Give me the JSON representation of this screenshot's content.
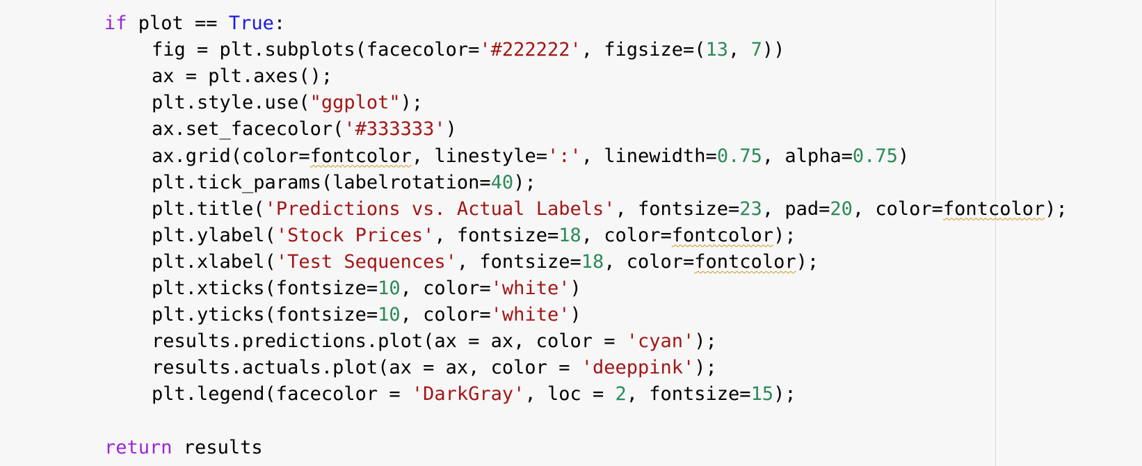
{
  "colors": {
    "background": "#f7f7f7",
    "keyword": "#9a26d6",
    "constant": "#1a1ae0",
    "string": "#a31515",
    "number": "#2b8a57",
    "default": "#000000",
    "squiggle": "#c89b1a",
    "ruler": "#dadada"
  },
  "code": {
    "lines": [
      {
        "indent": 1,
        "tokens": [
          {
            "t": "if",
            "k": "kw"
          },
          {
            "t": " plot == ",
            "k": "op"
          },
          {
            "t": "True",
            "k": "cn"
          },
          {
            "t": ":",
            "k": "op"
          }
        ]
      },
      {
        "indent": 2,
        "tokens": [
          {
            "t": "fig = plt.subplots(facecolor=",
            "k": "op"
          },
          {
            "t": "'#222222'",
            "k": "str"
          },
          {
            "t": ", figsize=(",
            "k": "op"
          },
          {
            "t": "13",
            "k": "num"
          },
          {
            "t": ", ",
            "k": "op"
          },
          {
            "t": "7",
            "k": "num"
          },
          {
            "t": "))",
            "k": "op"
          }
        ]
      },
      {
        "indent": 2,
        "tokens": [
          {
            "t": "ax = plt.axes();",
            "k": "op"
          }
        ]
      },
      {
        "indent": 2,
        "tokens": [
          {
            "t": "plt.style.use(",
            "k": "op"
          },
          {
            "t": "\"ggplot\"",
            "k": "str"
          },
          {
            "t": ");",
            "k": "op"
          }
        ]
      },
      {
        "indent": 2,
        "tokens": [
          {
            "t": "ax.set_facecolor(",
            "k": "op"
          },
          {
            "t": "'#333333'",
            "k": "str"
          },
          {
            "t": ")",
            "k": "op"
          }
        ]
      },
      {
        "indent": 2,
        "tokens": [
          {
            "t": "ax.grid(color=",
            "k": "op"
          },
          {
            "t": "fontcolor",
            "k": "op",
            "squiggle": true
          },
          {
            "t": ", linestyle=",
            "k": "op"
          },
          {
            "t": "':'",
            "k": "str"
          },
          {
            "t": ", linewidth=",
            "k": "op"
          },
          {
            "t": "0.75",
            "k": "num"
          },
          {
            "t": ", alpha=",
            "k": "op"
          },
          {
            "t": "0.75",
            "k": "num"
          },
          {
            "t": ")",
            "k": "op"
          }
        ]
      },
      {
        "indent": 2,
        "tokens": [
          {
            "t": "plt.tick_params(labelrotation=",
            "k": "op"
          },
          {
            "t": "40",
            "k": "num"
          },
          {
            "t": ");",
            "k": "op"
          }
        ]
      },
      {
        "indent": 2,
        "tokens": [
          {
            "t": "plt.title(",
            "k": "op"
          },
          {
            "t": "'Predictions vs. Actual Labels'",
            "k": "str"
          },
          {
            "t": ", fontsize=",
            "k": "op"
          },
          {
            "t": "23",
            "k": "num"
          },
          {
            "t": ", pad=",
            "k": "op"
          },
          {
            "t": "20",
            "k": "num"
          },
          {
            "t": ", color=",
            "k": "op"
          },
          {
            "t": "fontcolor",
            "k": "op",
            "squiggle": true
          },
          {
            "t": ");",
            "k": "op"
          }
        ]
      },
      {
        "indent": 2,
        "tokens": [
          {
            "t": "plt.ylabel(",
            "k": "op"
          },
          {
            "t": "'Stock Prices'",
            "k": "str"
          },
          {
            "t": ", fontsize=",
            "k": "op"
          },
          {
            "t": "18",
            "k": "num"
          },
          {
            "t": ", color=",
            "k": "op"
          },
          {
            "t": "fontcolor",
            "k": "op",
            "squiggle": true
          },
          {
            "t": ");",
            "k": "op"
          }
        ]
      },
      {
        "indent": 2,
        "tokens": [
          {
            "t": "plt.xlabel(",
            "k": "op"
          },
          {
            "t": "'Test Sequences'",
            "k": "str"
          },
          {
            "t": ", fontsize=",
            "k": "op"
          },
          {
            "t": "18",
            "k": "num"
          },
          {
            "t": ", color=",
            "k": "op"
          },
          {
            "t": "fontcolor",
            "k": "op",
            "squiggle": true
          },
          {
            "t": ");",
            "k": "op"
          }
        ]
      },
      {
        "indent": 2,
        "tokens": [
          {
            "t": "plt.xticks(fontsize=",
            "k": "op"
          },
          {
            "t": "10",
            "k": "num"
          },
          {
            "t": ", color=",
            "k": "op"
          },
          {
            "t": "'white'",
            "k": "str"
          },
          {
            "t": ")",
            "k": "op"
          }
        ]
      },
      {
        "indent": 2,
        "tokens": [
          {
            "t": "plt.yticks(fontsize=",
            "k": "op"
          },
          {
            "t": "10",
            "k": "num"
          },
          {
            "t": ", color=",
            "k": "op"
          },
          {
            "t": "'white'",
            "k": "str"
          },
          {
            "t": ")",
            "k": "op"
          }
        ]
      },
      {
        "indent": 2,
        "tokens": [
          {
            "t": "results.predictions.plot(ax = ax, color = ",
            "k": "op"
          },
          {
            "t": "'cyan'",
            "k": "str"
          },
          {
            "t": ");",
            "k": "op"
          }
        ]
      },
      {
        "indent": 2,
        "tokens": [
          {
            "t": "results.actuals.plot(ax = ax, color = ",
            "k": "op"
          },
          {
            "t": "'deeppink'",
            "k": "str"
          },
          {
            "t": ");",
            "k": "op"
          }
        ]
      },
      {
        "indent": 2,
        "tokens": [
          {
            "t": "plt.legend(facecolor = ",
            "k": "op"
          },
          {
            "t": "'DarkGray'",
            "k": "str"
          },
          {
            "t": ", loc = ",
            "k": "op"
          },
          {
            "t": "2",
            "k": "num"
          },
          {
            "t": ", fontsize=",
            "k": "op"
          },
          {
            "t": "15",
            "k": "num"
          },
          {
            "t": ");",
            "k": "op"
          }
        ]
      },
      {
        "indent": 1,
        "tokens": []
      },
      {
        "indent": 1,
        "tokens": [
          {
            "t": "return",
            "k": "kw"
          },
          {
            "t": " results",
            "k": "op"
          }
        ]
      }
    ]
  }
}
